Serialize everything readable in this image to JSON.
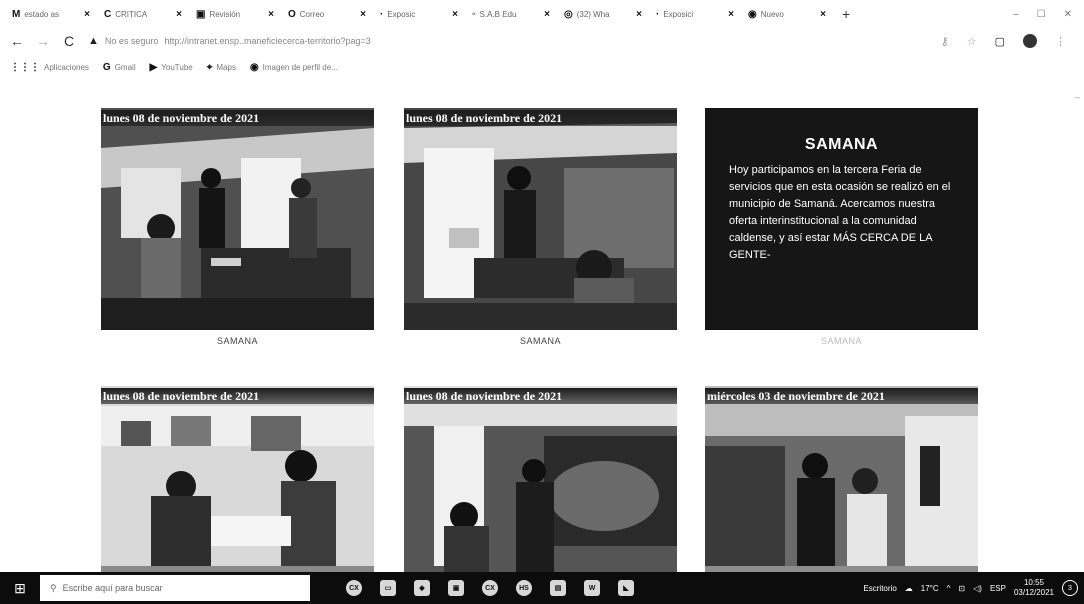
{
  "browser": {
    "tabs": [
      {
        "icon": "M",
        "label": "estado as"
      },
      {
        "icon": "C",
        "label": "CRITICA"
      },
      {
        "icon": "▣",
        "label": "Revisión"
      },
      {
        "icon": "O",
        "label": "Correo"
      },
      {
        "icon": "·",
        "label": "Exposic"
      },
      {
        "icon": "◦",
        "label": "S.A.B Edu"
      },
      {
        "icon": "◎",
        "label": "(32) Wha"
      },
      {
        "icon": "·",
        "label": "Exposici"
      },
      {
        "icon": "◉",
        "label": "Nuevo"
      }
    ],
    "new_tab": "+",
    "url_warning": "▲",
    "url_security": "No es seguro",
    "url_text": "http://intranet.ensp..maneficiecerca-territorio?pag=3",
    "bookmarks": [
      {
        "icon": "⋮⋮⋮",
        "label": "Aplicaciones"
      },
      {
        "icon": "G",
        "label": "Gmail"
      },
      {
        "icon": "▶",
        "label": "YouTube"
      },
      {
        "icon": "⌖",
        "label": "Maps"
      },
      {
        "icon": "◉",
        "label": "Imagen de perfil de..."
      }
    ]
  },
  "cards": [
    {
      "date": "lunes 08 de noviembre de 2021",
      "caption": "SAMANA"
    },
    {
      "date": "lunes 08 de noviembre de 2021",
      "caption": "SAMANA"
    },
    {
      "title": "SAMANA",
      "body": "Hoy participamos en la tercera Feria de servicios que en esta ocasión se realizó en el municipio de Samaná. Acercamos nuestra oferta interinstitucional a la comunidad caldense, y así estar MÁS CERCA DE LA GENTE-",
      "caption": "SAMANA"
    },
    {
      "date": "lunes 08 de noviembre de 2021",
      "caption": ""
    },
    {
      "date": "lunes 08 de noviembre de 2021",
      "caption": ""
    },
    {
      "date": "miércoles 03 de noviembre de 2021",
      "caption": ""
    }
  ],
  "taskbar": {
    "search_placeholder": "Escribe aquí para buscar",
    "apps": [
      "CX",
      "▭",
      "◆",
      "▣",
      "CX",
      "HS",
      "▤",
      "W",
      "◣"
    ],
    "desktop_label": "Escritorio",
    "weather": "17°C",
    "lang": "ESP",
    "time": "10:55",
    "date": "03/12/2021",
    "notifications": "3"
  }
}
